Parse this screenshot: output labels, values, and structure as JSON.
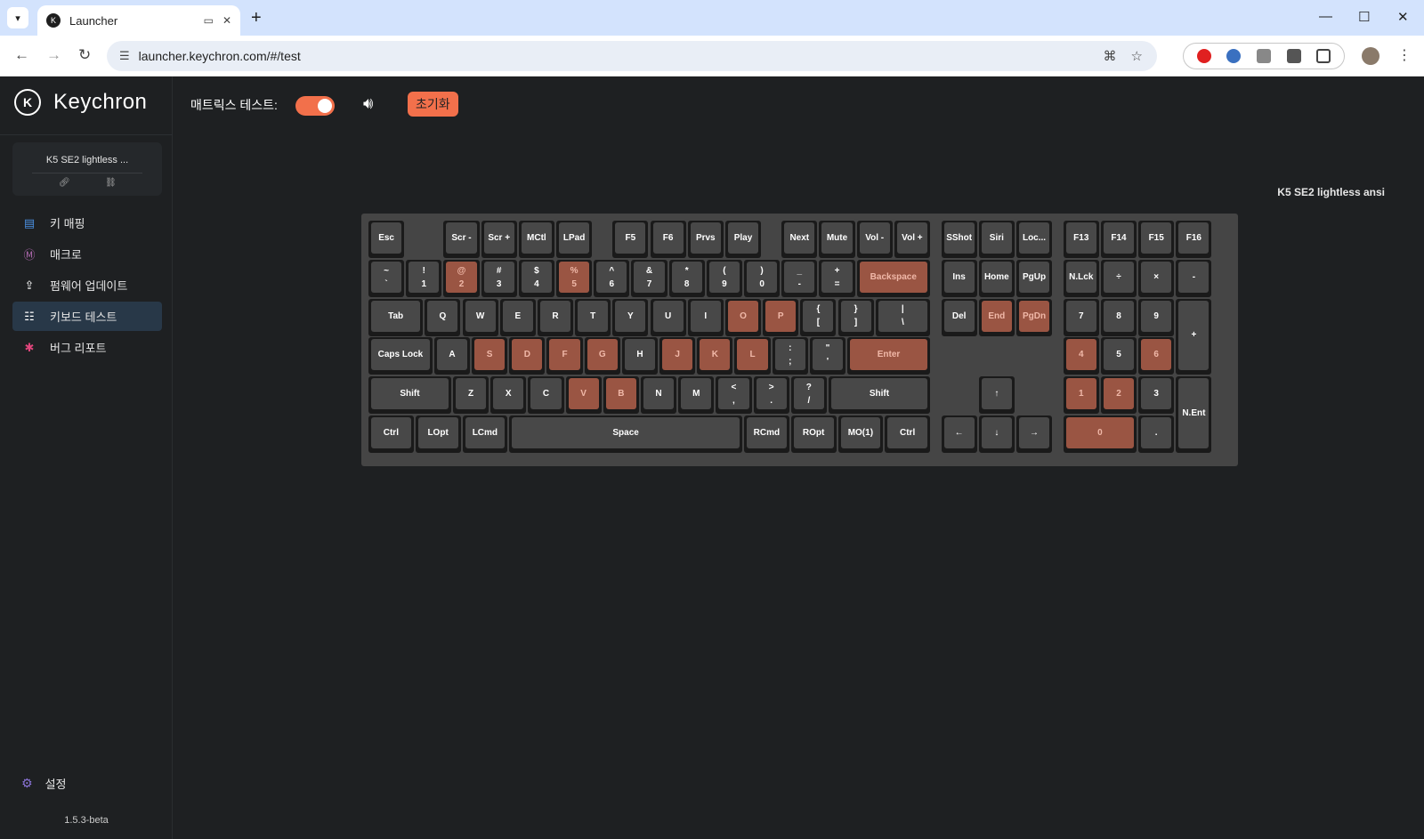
{
  "browser": {
    "tab_title": "Launcher",
    "url": "launcher.keychron.com/#/test"
  },
  "sidebar": {
    "brand": "Keychron",
    "device_name": "K5 SE2 lightless ...",
    "menu": [
      {
        "label": "키 매핑",
        "icon": "keymap-icon",
        "color": "#4a90e2"
      },
      {
        "label": "매크로",
        "icon": "macro-icon",
        "color": "#b06ab0"
      },
      {
        "label": "펌웨어 업데이트",
        "icon": "firmware-icon",
        "color": "#ffffff"
      },
      {
        "label": "키보드 테스트",
        "icon": "keyboard-test-icon",
        "color": "#ffffff",
        "active": true
      },
      {
        "label": "버그 리포트",
        "icon": "bug-icon",
        "color": "#e0457b"
      }
    ],
    "settings_label": "설정",
    "version": "1.5.3-beta"
  },
  "main": {
    "matrix_label": "매트릭스 테스트:",
    "matrix_on": true,
    "reset_label": "초기화",
    "keyboard_name": "K5 SE2 lightless ansi",
    "accent": "#f2704b"
  },
  "keys": [
    {
      "id": "esc",
      "t": "Esc",
      "on": false
    },
    {
      "id": "scr-minus",
      "t": "Scr -",
      "on": false
    },
    {
      "id": "scr-plus",
      "t": "Scr +",
      "on": false
    },
    {
      "id": "mctl",
      "t": "MCtl",
      "on": false
    },
    {
      "id": "lpad",
      "t": "LPad",
      "on": false
    },
    {
      "id": "f5",
      "t": "F5",
      "on": false
    },
    {
      "id": "f6",
      "t": "F6",
      "on": false
    },
    {
      "id": "prvs",
      "t": "Prvs",
      "on": false
    },
    {
      "id": "play",
      "t": "Play",
      "on": false
    },
    {
      "id": "next",
      "t": "Next",
      "on": false
    },
    {
      "id": "mute",
      "t": "Mute",
      "on": false
    },
    {
      "id": "vol-minus",
      "t": "Vol -",
      "on": false
    },
    {
      "id": "vol-plus",
      "t": "Vol +",
      "on": false
    },
    {
      "id": "sshot",
      "t": "SShot",
      "on": false
    },
    {
      "id": "siri",
      "t": "Siri",
      "on": false
    },
    {
      "id": "lock",
      "t": "Loc...",
      "on": false
    },
    {
      "id": "f13",
      "t": "F13",
      "on": false
    },
    {
      "id": "f14",
      "t": "F14",
      "on": false
    },
    {
      "id": "f15",
      "t": "F15",
      "on": false
    },
    {
      "id": "f16",
      "t": "F16",
      "on": false
    },
    {
      "id": "grave",
      "t": "~",
      "b": "`",
      "on": false
    },
    {
      "id": "1",
      "t": "!",
      "b": "1",
      "on": false
    },
    {
      "id": "2",
      "t": "@",
      "b": "2",
      "on": true
    },
    {
      "id": "3",
      "t": "#",
      "b": "3",
      "on": false
    },
    {
      "id": "4",
      "t": "$",
      "b": "4",
      "on": false
    },
    {
      "id": "5",
      "t": "%",
      "b": "5",
      "on": true
    },
    {
      "id": "6",
      "t": "^",
      "b": "6",
      "on": false
    },
    {
      "id": "7",
      "t": "&",
      "b": "7",
      "on": false
    },
    {
      "id": "8",
      "t": "*",
      "b": "8",
      "on": false
    },
    {
      "id": "9",
      "t": "(",
      "b": "9",
      "on": false
    },
    {
      "id": "0",
      "t": ")",
      "b": "0",
      "on": false
    },
    {
      "id": "minus",
      "t": "_",
      "b": "-",
      "on": false
    },
    {
      "id": "equal",
      "t": "+",
      "b": "=",
      "on": false
    },
    {
      "id": "backspace",
      "t": "Backspace",
      "on": true
    },
    {
      "id": "ins",
      "t": "Ins",
      "on": false
    },
    {
      "id": "home",
      "t": "Home",
      "on": false
    },
    {
      "id": "pgup",
      "t": "PgUp",
      "on": false
    },
    {
      "id": "nlck",
      "t": "N.Lck",
      "on": false
    },
    {
      "id": "kp-div",
      "t": "÷",
      "on": false
    },
    {
      "id": "kp-mul",
      "t": "×",
      "on": false
    },
    {
      "id": "kp-minus",
      "t": "-",
      "on": false
    },
    {
      "id": "tab",
      "t": "Tab",
      "on": false
    },
    {
      "id": "q",
      "t": "Q",
      "on": false
    },
    {
      "id": "w",
      "t": "W",
      "on": false
    },
    {
      "id": "e",
      "t": "E",
      "on": false
    },
    {
      "id": "r",
      "t": "R",
      "on": false
    },
    {
      "id": "t",
      "t": "T",
      "on": false
    },
    {
      "id": "y",
      "t": "Y",
      "on": false
    },
    {
      "id": "u",
      "t": "U",
      "on": false
    },
    {
      "id": "i",
      "t": "I",
      "on": false
    },
    {
      "id": "o",
      "t": "O",
      "on": true
    },
    {
      "id": "p",
      "t": "P",
      "on": true
    },
    {
      "id": "lbracket",
      "t": "{",
      "b": "[",
      "on": false
    },
    {
      "id": "rbracket",
      "t": "}",
      "b": "]",
      "on": false
    },
    {
      "id": "backslash",
      "t": "|",
      "b": "\\",
      "on": false
    },
    {
      "id": "del",
      "t": "Del",
      "on": false
    },
    {
      "id": "end",
      "t": "End",
      "on": true
    },
    {
      "id": "pgdn",
      "t": "PgDn",
      "on": true
    },
    {
      "id": "kp7",
      "t": "7",
      "on": false
    },
    {
      "id": "kp8",
      "t": "8",
      "on": false
    },
    {
      "id": "kp9",
      "t": "9",
      "on": false
    },
    {
      "id": "kp-plus",
      "t": "+",
      "on": false
    },
    {
      "id": "caps",
      "t": "Caps Lock",
      "on": false
    },
    {
      "id": "a",
      "t": "A",
      "on": false
    },
    {
      "id": "s",
      "t": "S",
      "on": true
    },
    {
      "id": "d",
      "t": "D",
      "on": true
    },
    {
      "id": "f",
      "t": "F",
      "on": true
    },
    {
      "id": "g",
      "t": "G",
      "on": true
    },
    {
      "id": "h",
      "t": "H",
      "on": false
    },
    {
      "id": "j",
      "t": "J",
      "on": true
    },
    {
      "id": "k",
      "t": "K",
      "on": true
    },
    {
      "id": "l",
      "t": "L",
      "on": true
    },
    {
      "id": "semicolon",
      "t": ":",
      "b": ";",
      "on": false
    },
    {
      "id": "quote",
      "t": "\"",
      "b": "'",
      "on": false
    },
    {
      "id": "enter",
      "t": "Enter",
      "on": true
    },
    {
      "id": "kp4",
      "t": "4",
      "on": true
    },
    {
      "id": "kp5",
      "t": "5",
      "on": false
    },
    {
      "id": "kp6",
      "t": "6",
      "on": true
    },
    {
      "id": "lshift",
      "t": "Shift",
      "on": false
    },
    {
      "id": "z",
      "t": "Z",
      "on": false
    },
    {
      "id": "x",
      "t": "X",
      "on": false
    },
    {
      "id": "c",
      "t": "C",
      "on": false
    },
    {
      "id": "v",
      "t": "V",
      "on": true
    },
    {
      "id": "b",
      "t": "B",
      "on": true
    },
    {
      "id": "n",
      "t": "N",
      "on": false
    },
    {
      "id": "m",
      "t": "M",
      "on": false
    },
    {
      "id": "comma",
      "t": "<",
      "b": ",",
      "on": false
    },
    {
      "id": "period",
      "t": ">",
      "b": ".",
      "on": false
    },
    {
      "id": "slash",
      "t": "?",
      "b": "/",
      "on": false
    },
    {
      "id": "rshift",
      "t": "Shift",
      "on": false
    },
    {
      "id": "up",
      "t": "↑",
      "on": false
    },
    {
      "id": "kp1",
      "t": "1",
      "on": true
    },
    {
      "id": "kp2",
      "t": "2",
      "on": true
    },
    {
      "id": "kp3",
      "t": "3",
      "on": false
    },
    {
      "id": "kp-enter",
      "t": "N.Ent",
      "on": false
    },
    {
      "id": "lctrl",
      "t": "Ctrl",
      "on": false
    },
    {
      "id": "lopt",
      "t": "LOpt",
      "on": false
    },
    {
      "id": "lcmd",
      "t": "LCmd",
      "on": false
    },
    {
      "id": "space",
      "t": "Space",
      "on": false
    },
    {
      "id": "rcmd",
      "t": "RCmd",
      "on": false
    },
    {
      "id": "ropt",
      "t": "ROpt",
      "on": false
    },
    {
      "id": "mo1",
      "t": "MO(1)",
      "on": false
    },
    {
      "id": "rctrl",
      "t": "Ctrl",
      "on": false
    },
    {
      "id": "left",
      "t": "←",
      "on": false
    },
    {
      "id": "down",
      "t": "↓",
      "on": false
    },
    {
      "id": "right",
      "t": "→",
      "on": false
    },
    {
      "id": "kp0",
      "t": "0",
      "on": true
    },
    {
      "id": "kp-dot",
      "t": ".",
      "on": false
    }
  ]
}
